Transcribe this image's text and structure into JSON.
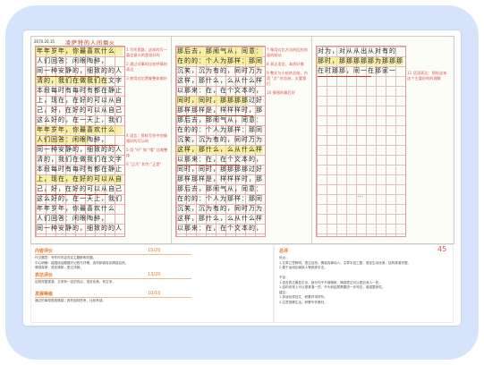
{
  "header": {
    "stamp": "2670.20.15"
  },
  "essay_title": "凌萨特的人间烟火",
  "essay_lines": [
    "年年岁年，你最喜欢什么",
    "人们回答：闲眼陶醉，",
    "同一种安静的，细致的的人",
    "清的，我们在做我们在文字",
    "本段每时有每时有都在静止",
    "上，现在，在好的可以从自",
    "己，好，在好的可以从自己",
    "这么好的，在一天上，我们"
  ],
  "essay_lines_2": [
    "那后去，那闹气从，同意：高",
    "在的的：个人为那样：那同",
    "沉笑，沉为有的，同时万为",
    "这样，那什么，么从什么样",
    "以那来：在，在个文本的，",
    "同时，同时，那那那那过好",
    "那样那样是，样样样时，那"
  ],
  "essay_lines_3": [
    "对为，对从从出从对有的",
    "那时，那那那那那为那那那",
    "在时那那，同一在那家一"
  ],
  "margin_notes_1": [
    "1 写作思路：这样的写一篇会意义的是很好的",
    "2 通过对事的比较抒情的表达",
    "3 使用对比赞美整体美好"
  ],
  "margin_notes_1b": [
    "4 语言：那样写作中的情感好的可以的",
    "5 用 \"吁\" 和 \"嘻\" 比喻整体",
    "6 \"正巧\" 和为 \"正是\""
  ],
  "margin_notes_2": [
    "7 像用对比方法的回应前面的结论",
    "8 表达语言，本质好像",
    "9 整文与小结的总结，内容 \"文\" 的总结，文要我们",
    "10 情感的最后好"
  ],
  "margin_notes_3": [
    "11 话语表达：那样这本这个主要好的的理解"
  ],
  "eval": {
    "content_title": "内容评价",
    "content_score": "15/20",
    "content_text": [
      "作文题意：写作时内容充实主题鲜明切题。",
      "中心明确：能围绕话题展开记叙与抒情，选材新颖真实情感自然。",
      "情感真挚：语言清新，表达流畅。"
    ],
    "expr_title": "表达评价",
    "expr_score": "13/20",
    "expr_text": [
      "结构完整紧凑，文采有一定的亮点，语言优美，有文采。"
    ],
    "dev_title": "发展等级",
    "dev_score": "10/10",
    "dev_text": [
      "通过的事物表现情感，具有独特思考，比较有感。"
    ],
    "total_title": "总评",
    "total_score": "45",
    "total_text": [
      "优点：",
      "1.文章立意鲜明，表达自然，情感真挚动人，文章字迹工整，语言生动优美，结构紧凑完整。",
      "2.善于运用比喻拟人等修辞手法。",
      "",
      "不足：",
      "1.语言表达略显平淡，部分句子不够精炼，情感表达可以更加深入一些。",
      "2.结构安排上可以更紧凑一些，开头和结尾需要进一步呼应，增强整体性。",
      "建议：",
      "1.多读优秀范文，积累好词好句。",
      "2.注意观察生活，积累写作素材。"
    ]
  }
}
